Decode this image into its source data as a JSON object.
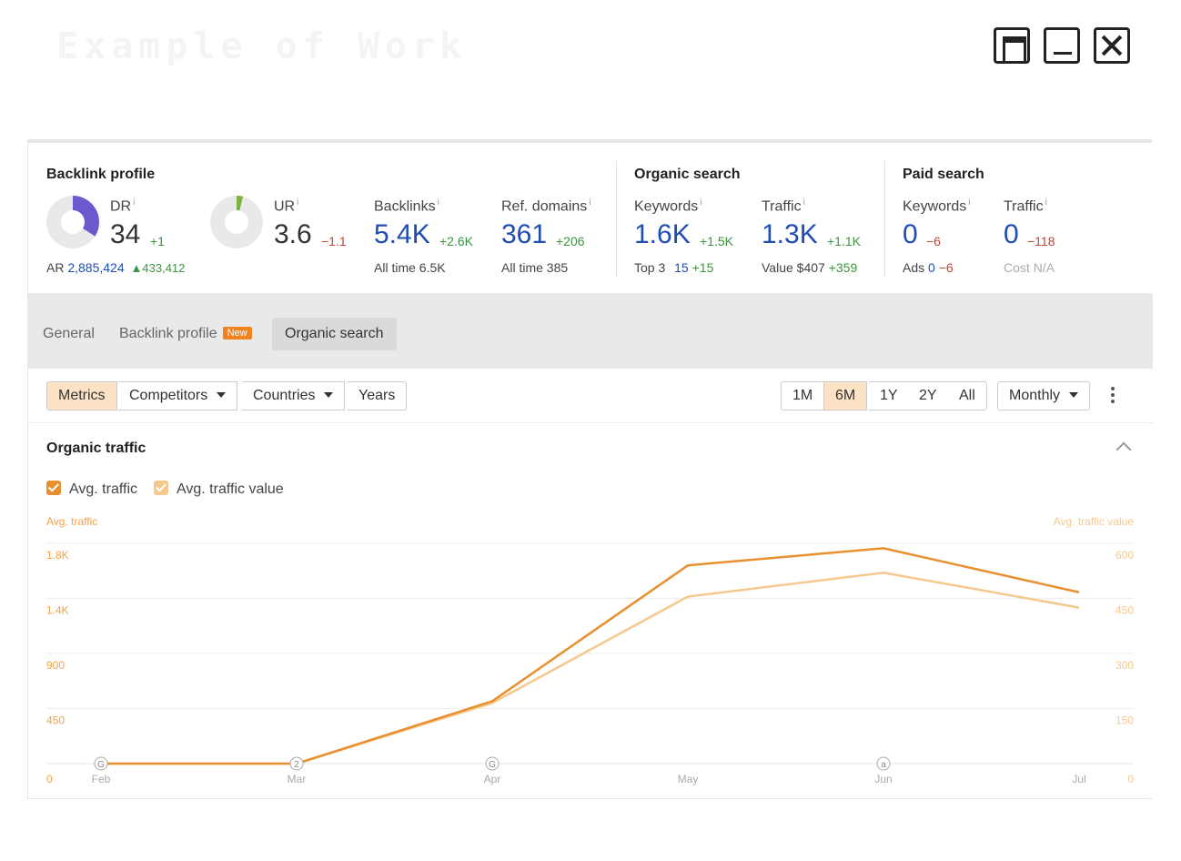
{
  "window": {
    "title": "Example of Work"
  },
  "backlink_profile": {
    "title": "Backlink profile",
    "dr": {
      "label": "DR",
      "value": "34",
      "delta": "+1",
      "fill_percent": 34
    },
    "ur": {
      "label": "UR",
      "value": "3.6",
      "delta": "−1.1",
      "fill_percent": 4
    },
    "ar": {
      "label": "AR",
      "value": "2,885,424",
      "delta": "▲433,412"
    },
    "backlinks": {
      "label": "Backlinks",
      "value": "5.4K",
      "delta": "+2.6K",
      "sub_label": "All time",
      "sub_value": "6.5K"
    },
    "ref_domains": {
      "label": "Ref. domains",
      "value": "361",
      "delta": "+206",
      "sub_label": "All time",
      "sub_value": "385"
    }
  },
  "organic_search": {
    "title": "Organic search",
    "keywords": {
      "label": "Keywords",
      "value": "1.6K",
      "delta": "+1.5K",
      "sub_label": "Top 3",
      "sub_value": "15",
      "sub_delta": "+15"
    },
    "traffic": {
      "label": "Traffic",
      "value": "1.3K",
      "delta": "+1.1K",
      "sub_label": "Value",
      "sub_value": "$407",
      "sub_delta": "+359"
    }
  },
  "paid_search": {
    "title": "Paid search",
    "keywords": {
      "label": "Keywords",
      "value": "0",
      "delta": "−6",
      "sub_label": "Ads",
      "sub_value": "0",
      "sub_delta": "−6"
    },
    "traffic": {
      "label": "Traffic",
      "value": "0",
      "delta": "−118",
      "sub_label": "Cost",
      "sub_value": "N/A"
    }
  },
  "info_mark": "i",
  "tabs": [
    {
      "label": "General"
    },
    {
      "label": "Backlink profile",
      "badge": "New"
    },
    {
      "label": "Organic search"
    }
  ],
  "toolbar": {
    "metrics": "Metrics",
    "competitors": "Competitors",
    "countries": "Countries",
    "years": "Years",
    "ranges": [
      "1M",
      "6M",
      "1Y",
      "2Y",
      "All"
    ],
    "active_range": "6M",
    "granularity": "Monthly"
  },
  "chart_panel": {
    "title": "Organic traffic",
    "legend": [
      {
        "label": "Avg. traffic",
        "color": "#e8902f"
      },
      {
        "label": "Avg. traffic value",
        "color": "#f5c88e"
      }
    ]
  },
  "chart_data": {
    "type": "line",
    "x": [
      "Feb",
      "Mar",
      "Apr",
      "May",
      "Jun",
      "Jul"
    ],
    "left_axis": {
      "title": "Avg. traffic",
      "ticks": [
        "0",
        "450",
        "900",
        "1.4K",
        "1.8K"
      ],
      "ylim": [
        0,
        1800
      ]
    },
    "right_axis": {
      "title": "Avg. traffic value",
      "ticks": [
        "0",
        "150",
        "300",
        "450",
        "600"
      ],
      "ylim": [
        0,
        600
      ]
    },
    "series": [
      {
        "name": "Avg. traffic",
        "axis": "left",
        "color": "#e8902f",
        "values": [
          0,
          0,
          510,
          1620,
          1760,
          1400
        ]
      },
      {
        "name": "Avg. traffic value",
        "axis": "right",
        "color": "#f5c88e",
        "values": [
          0,
          0,
          165,
          455,
          520,
          425
        ]
      }
    ],
    "annotations": [
      {
        "x": "Feb",
        "label": "G"
      },
      {
        "x": "Mar",
        "label": "2"
      },
      {
        "x": "Apr",
        "label": "G"
      },
      {
        "x": "Jun",
        "label": "a"
      }
    ],
    "grid": true
  }
}
